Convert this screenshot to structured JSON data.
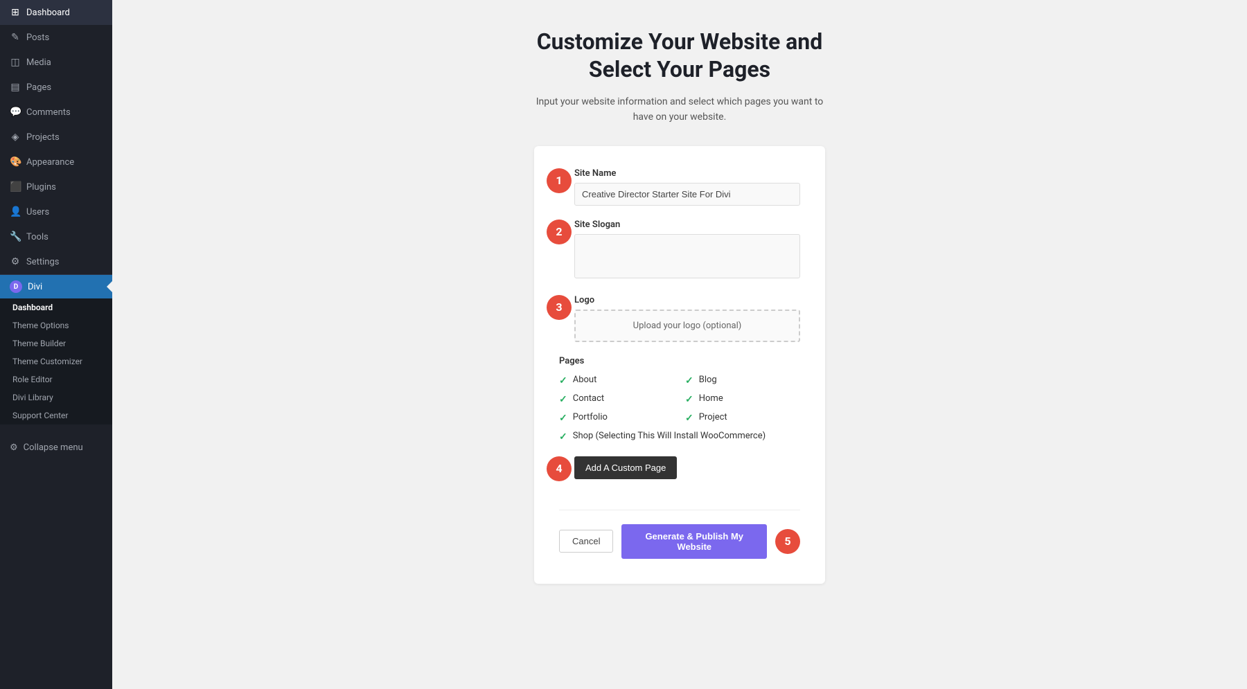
{
  "sidebar": {
    "items": [
      {
        "id": "dashboard",
        "label": "Dashboard",
        "icon": "⊞"
      },
      {
        "id": "posts",
        "label": "Posts",
        "icon": "✏"
      },
      {
        "id": "media",
        "label": "Media",
        "icon": "⬛"
      },
      {
        "id": "pages",
        "label": "Pages",
        "icon": "⬛"
      },
      {
        "id": "comments",
        "label": "Comments",
        "icon": "💬"
      },
      {
        "id": "projects",
        "label": "Projects",
        "icon": "⚙"
      },
      {
        "id": "appearance",
        "label": "Appearance",
        "icon": "🎨"
      },
      {
        "id": "plugins",
        "label": "Plugins",
        "icon": "⬛"
      },
      {
        "id": "users",
        "label": "Users",
        "icon": "👤"
      },
      {
        "id": "tools",
        "label": "Tools",
        "icon": "🔧"
      },
      {
        "id": "settings",
        "label": "Settings",
        "icon": "⚙"
      }
    ],
    "divi": {
      "label": "Divi",
      "sub_items": [
        {
          "id": "dashboard",
          "label": "Dashboard",
          "active": true
        },
        {
          "id": "theme-options",
          "label": "Theme Options"
        },
        {
          "id": "theme-builder",
          "label": "Theme Builder"
        },
        {
          "id": "theme-customizer",
          "label": "Theme Customizer"
        },
        {
          "id": "role-editor",
          "label": "Role Editor"
        },
        {
          "id": "divi-library",
          "label": "Divi Library"
        },
        {
          "id": "support-center",
          "label": "Support Center"
        }
      ]
    },
    "collapse_label": "Collapse menu"
  },
  "main": {
    "title_line1": "Customize Your Website and",
    "title_line2": "Select Your Pages",
    "subtitle": "Input your website information and select which pages you want to have on your website.",
    "steps": {
      "step1": "1",
      "step2": "2",
      "step3": "3",
      "step4": "4",
      "step5": "5"
    },
    "form": {
      "site_name_label": "Site Name",
      "site_name_value": "Creative Director Starter Site For Divi",
      "site_name_placeholder": "Creative Director Starter Site For Divi",
      "site_slogan_label": "Site Slogan",
      "site_slogan_placeholder": "",
      "logo_label": "Logo",
      "logo_upload_text": "Upload your logo (optional)",
      "pages_label": "Pages",
      "pages": [
        {
          "id": "about",
          "label": "About",
          "checked": true,
          "col": 1
        },
        {
          "id": "blog",
          "label": "Blog",
          "checked": true,
          "col": 2
        },
        {
          "id": "contact",
          "label": "Contact",
          "checked": true,
          "col": 1
        },
        {
          "id": "home",
          "label": "Home",
          "checked": true,
          "col": 2
        },
        {
          "id": "portfolio",
          "label": "Portfolio",
          "checked": true,
          "col": 1
        },
        {
          "id": "project",
          "label": "Project",
          "checked": true,
          "col": 2
        },
        {
          "id": "shop",
          "label": "Shop (Selecting This Will Install WooCommerce)",
          "checked": true,
          "col": 1,
          "full": true
        }
      ],
      "add_custom_page_label": "Add A Custom Page",
      "cancel_label": "Cancel",
      "generate_label": "Generate & Publish My Website"
    }
  }
}
